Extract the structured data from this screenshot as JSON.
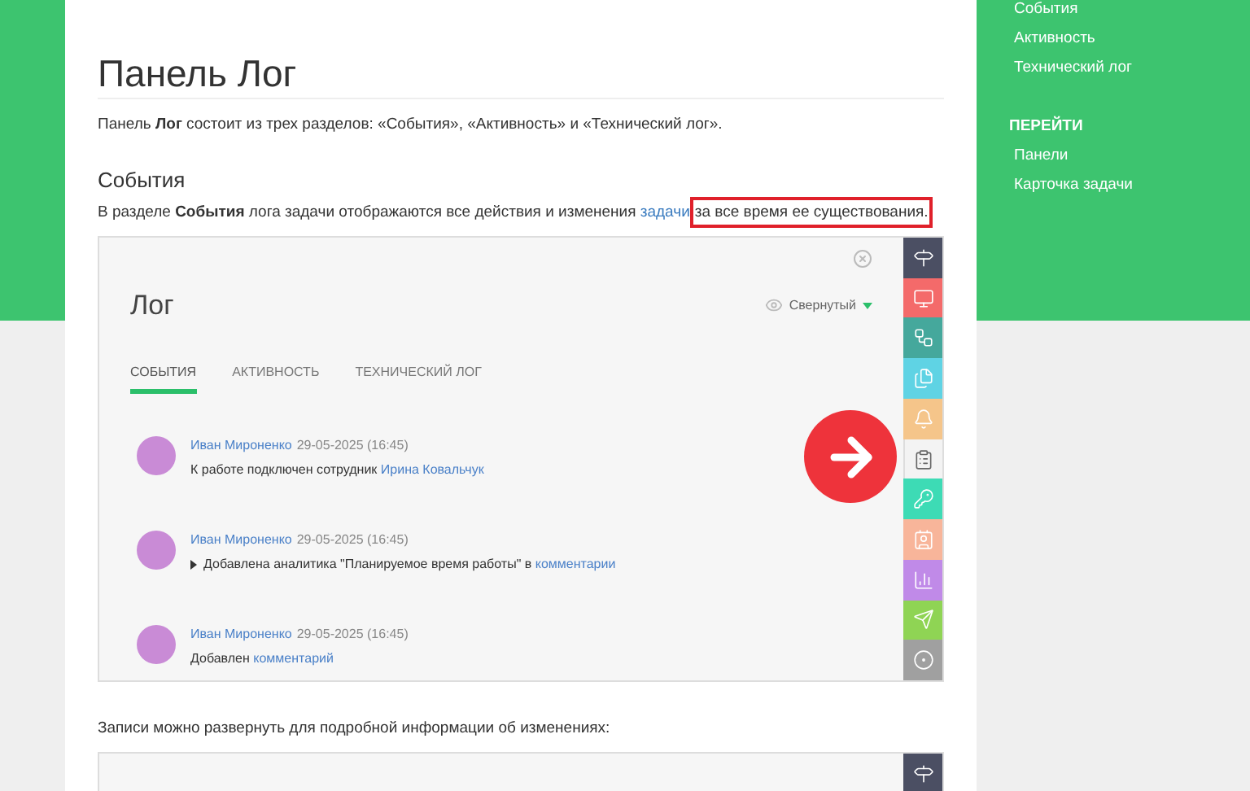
{
  "nav": {
    "items": [
      {
        "label": "События"
      },
      {
        "label": "Активность"
      },
      {
        "label": "Технический лог"
      }
    ],
    "section_title": "ПЕРЕЙТИ",
    "links": [
      {
        "label": "Панели"
      },
      {
        "label": "Карточка задачи"
      }
    ]
  },
  "article": {
    "title": "Панель Лог",
    "intro": "Панель **Лог** состоит из трех разделов: «События», «Активность» и «Технический лог».",
    "section_heading": "События",
    "paragraph": {
      "before": "В разделе **События** лога задачи отображаются все действия и изменения ",
      "link": "задачи",
      "highlighted": "за все время ее существования."
    },
    "caption": "Записи можно развернуть для подробной информации об изменениях:"
  },
  "screenshot": {
    "title": "Лог",
    "view_mode": "Свернутый",
    "tabs": [
      {
        "label": "СОБЫТИЯ",
        "selected": true
      },
      {
        "label": "АКТИВНОСТЬ",
        "selected": false
      },
      {
        "label": "ТЕХНИЧЕСКИЙ ЛОГ",
        "selected": false
      }
    ],
    "entries": [
      {
        "author": "Иван Мироненко",
        "timestamp": "29-05-2025 (16:45)",
        "expandable": false,
        "parts": [
          {
            "text": "К работе подключен сотрудник ",
            "link": false
          },
          {
            "text": "Ирина Ковальчук",
            "link": true
          }
        ]
      },
      {
        "author": "Иван Мироненко",
        "timestamp": "29-05-2025 (16:45)",
        "expandable": true,
        "parts": [
          {
            "text": "Добавлена аналитика \"Планируемое время работы\" в ",
            "link": false
          },
          {
            "text": "комментарии",
            "link": true
          }
        ]
      },
      {
        "author": "Иван Мироненко",
        "timestamp": "29-05-2025 (16:45)",
        "expandable": false,
        "parts": [
          {
            "text": "Добавлен ",
            "link": false
          },
          {
            "text": "комментарий",
            "link": true
          }
        ]
      }
    ],
    "side_buttons": [
      {
        "color": "#4b4f63",
        "selected": false
      },
      {
        "color": "#f46a6a",
        "selected": false
      },
      {
        "color": "#45a89c",
        "selected": false
      },
      {
        "color": "#5fd3e4",
        "selected": false
      },
      {
        "color": "#f5c58a",
        "selected": false
      },
      {
        "color": "#f3f3f3",
        "selected": true
      },
      {
        "color": "#3ddbb5",
        "selected": false
      },
      {
        "color": "#f8b59a",
        "selected": false
      },
      {
        "color": "#c08ae8",
        "selected": false
      },
      {
        "color": "#8fd454",
        "selected": false
      },
      {
        "color": "#a0a0a0",
        "selected": false
      }
    ]
  },
  "screenshot_2": {
    "side_buttons": [
      {
        "color": "#4b4f63",
        "selected": false
      }
    ]
  }
}
